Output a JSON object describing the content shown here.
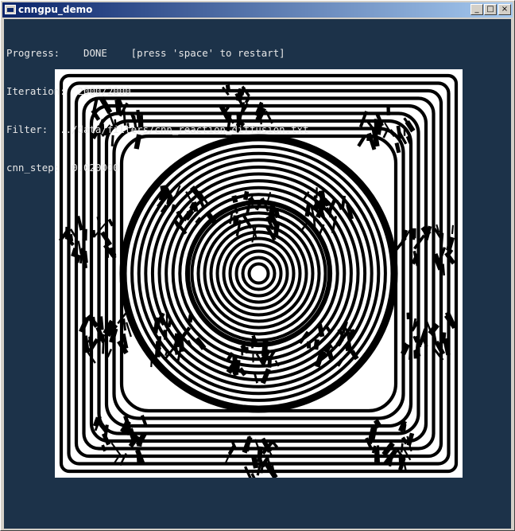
{
  "window": {
    "title": "cnngpu_demo",
    "controls": {
      "minimize": "_",
      "maximize": "□",
      "close": "×"
    }
  },
  "hud": {
    "progress_label": "Progress:",
    "progress_value": "DONE",
    "progress_hint": "[press 'space' to restart]",
    "iteration_label": "Iteration:",
    "iteration_value": "2000/2000",
    "filter_label": "Filter:",
    "filter_value": "../data/filters/cnn_reaction_diffusion.txt",
    "step_label": "cnn_step:",
    "step_value": "0.020000"
  },
  "colors": {
    "background": "#1c3249",
    "text": "#e8e8e8",
    "stripe_dark": "#000000",
    "stripe_light": "#ffffff"
  },
  "icons": {
    "app": "app-window-icon",
    "minimize": "minimize-icon",
    "maximize": "maximize-icon",
    "close": "close-icon"
  }
}
